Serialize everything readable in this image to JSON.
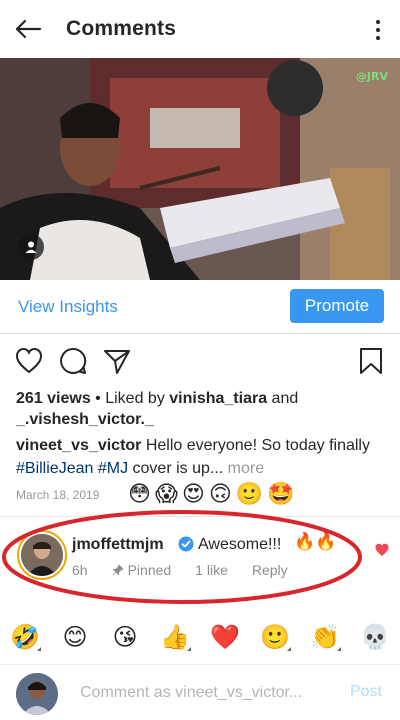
{
  "header": {
    "title": "Comments",
    "back_icon": "arrow-left-icon",
    "more_icon": "more-vertical-icon"
  },
  "media": {
    "watermark": "@JRV",
    "user_tag_icon": "user-icon"
  },
  "insights": {
    "view_insights": "View Insights",
    "promote": "Promote",
    "accent": "#3897f0"
  },
  "actions": {
    "like_icon": "heart-outline-icon",
    "comment_icon": "comment-icon",
    "share_icon": "send-icon",
    "save_icon": "bookmark-icon"
  },
  "post": {
    "views": "261 views",
    "liked_by_prefix": " • Liked by ",
    "liked_by_user": "vinisha_tiara",
    "liked_by_and": " and",
    "liked_by_user2": "_.vishesh_victor._",
    "caption_user": "vineet_vs_victor",
    "caption_text_1": " Hello everyone! So today finally ",
    "hashtag_1": "#BillieJean",
    "hashtag_2": "#MJ",
    "caption_text_2": " cover is up...",
    "more": " more",
    "date": "March 18, 2019",
    "reaction_emojis": [
      "😳",
      "😱",
      "😍",
      "🙃",
      "🙂",
      "🤩"
    ]
  },
  "pinned_comment": {
    "username": "jmoffettmjm",
    "verified_icon": "verified-badge-icon",
    "text": "Awesome!!!",
    "fire": "🔥🔥",
    "time": "6h",
    "pinned": "Pinned",
    "likes": "1 like",
    "reply": "Reply",
    "heart_color": "#ed4956",
    "highlight_color": "#d9252c"
  },
  "emoji_bar": [
    "🤣",
    "😊",
    "😘",
    "👍",
    "❤️",
    "🙂",
    "👏",
    "💀"
  ],
  "composer": {
    "placeholder": "Comment as vineet_vs_victor...",
    "post": "Post"
  }
}
